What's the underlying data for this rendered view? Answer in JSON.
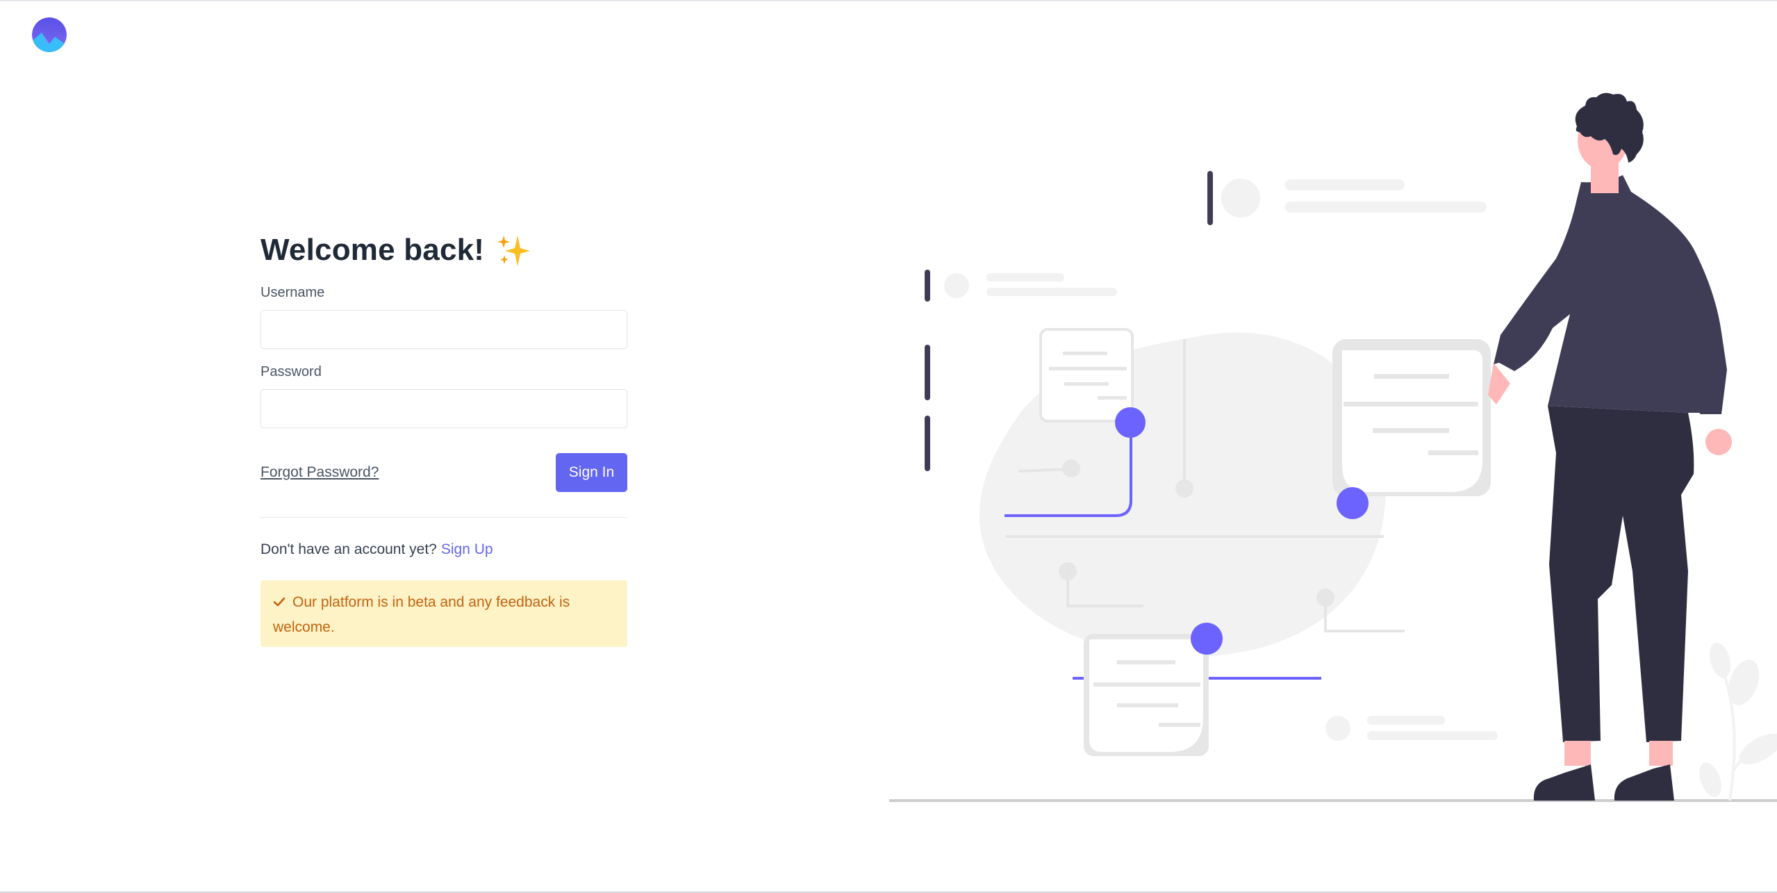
{
  "app": {
    "logo_icon": "app-logo-icon"
  },
  "login": {
    "title": "Welcome back!",
    "title_icon": "sparkles-icon",
    "username_label": "Username",
    "username_value": "",
    "password_label": "Password",
    "password_value": "",
    "forgot_password": "Forgot Password?",
    "sign_in": "Sign In",
    "no_account_text": "Don't have an account yet?",
    "sign_up": "Sign Up",
    "beta_notice": "Our platform is in beta and any feedback is welcome.",
    "beta_notice_icon": "check-icon"
  },
  "colors": {
    "accent": "#6366f1",
    "heading": "#1f2937",
    "notice_bg": "#fef3c7",
    "notice_text": "#c2630f",
    "illustration_dark": "#3f3d56",
    "illustration_skin": "#ffb8b8"
  },
  "illustration": {
    "icon": "person-with-documents-illustration"
  }
}
